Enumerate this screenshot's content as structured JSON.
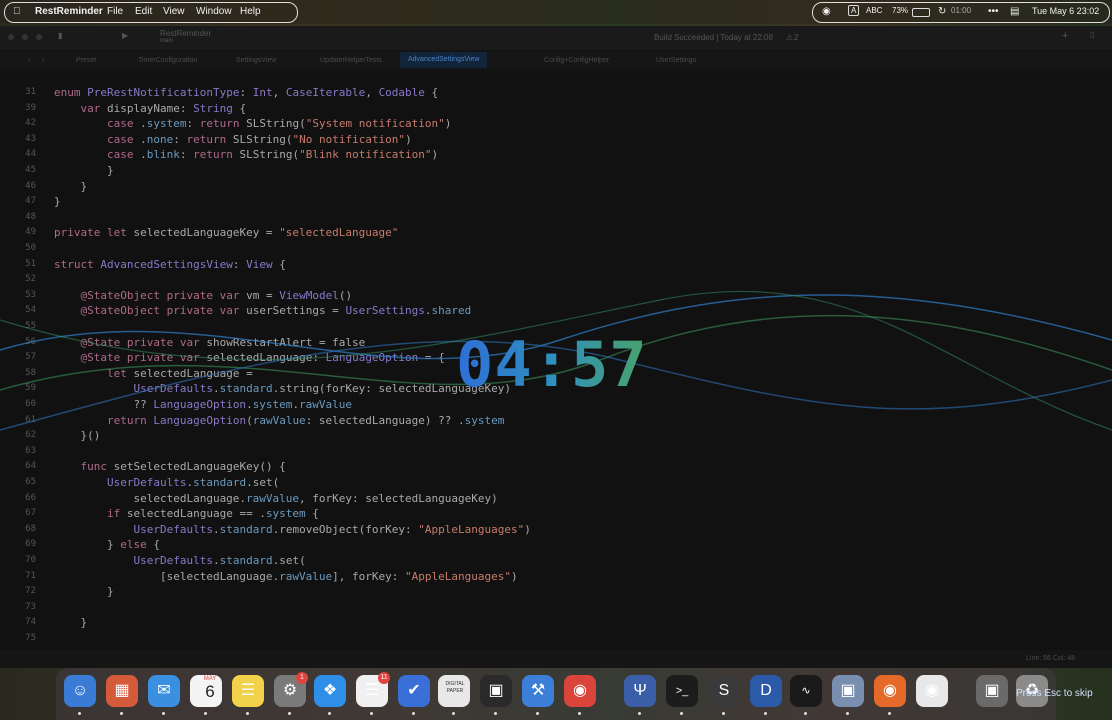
{
  "menubar": {
    "app_name": "RestReminder",
    "menus": [
      "File",
      "Edit",
      "View",
      "Window",
      "Help"
    ],
    "input_source": "ABC",
    "battery": "73%",
    "sync_time": "01:00",
    "datetime": "Tue May 6  23:02"
  },
  "toolbar": {
    "scheme": "RestReminder",
    "branch": "main",
    "build_status": "Build Succeeded | Today at 22:08",
    "warnings": "2"
  },
  "tabs": [
    "Preset",
    "TimerConfiguration",
    "SettingsView",
    "UpdaterHelperTests",
    "AdvancedSettingsView",
    "Config+ConfigHelper",
    "UserSettings"
  ],
  "active_tab": "AdvancedSettingsView",
  "code_lines": [
    {
      "n": "31",
      "t": "enum PreRestNotificationType: Int, CaseIterable, Codable {"
    },
    {
      "n": "39",
      "t": "    var displayName: String {"
    },
    {
      "n": "42",
      "t": "        case .system: return SLString(\"System notification\")"
    },
    {
      "n": "43",
      "t": "        case .none: return SLString(\"No notification\")"
    },
    {
      "n": "44",
      "t": "        case .blink: return SLString(\"Blink notification\")"
    },
    {
      "n": "45",
      "t": "        }"
    },
    {
      "n": "46",
      "t": "    }"
    },
    {
      "n": "47",
      "t": "}"
    },
    {
      "n": "48",
      "t": ""
    },
    {
      "n": "49",
      "t": "private let selectedLanguageKey = \"selectedLanguage\""
    },
    {
      "n": "50",
      "t": ""
    },
    {
      "n": "51",
      "t": "struct AdvancedSettingsView: View {"
    },
    {
      "n": "52",
      "t": ""
    },
    {
      "n": "53",
      "t": "    @StateObject private var vm = ViewModel()"
    },
    {
      "n": "54",
      "t": "    @StateObject private var userSettings = UserSettings.shared"
    },
    {
      "n": "55",
      "t": ""
    },
    {
      "n": "56",
      "t": "    @State private var showRestartAlert = false"
    },
    {
      "n": "57",
      "t": "    @State private var selectedLanguage: LanguageOption = {"
    },
    {
      "n": "58",
      "t": "        let selectedLanguage ="
    },
    {
      "n": "59",
      "t": "            UserDefaults.standard.string(forKey: selectedLanguageKey)"
    },
    {
      "n": "60",
      "t": "            ?? LanguageOption.system.rawValue"
    },
    {
      "n": "61",
      "t": "        return LanguageOption(rawValue: selectedLanguage) ?? .system"
    },
    {
      "n": "62",
      "t": "    }()"
    },
    {
      "n": "63",
      "t": ""
    },
    {
      "n": "64",
      "t": "    func setSelectedLanguageKey() {"
    },
    {
      "n": "65",
      "t": "        UserDefaults.standard.set("
    },
    {
      "n": "66",
      "t": "            selectedLanguage.rawValue, forKey: selectedLanguageKey)"
    },
    {
      "n": "67",
      "t": "        if selectedLanguage == .system {"
    },
    {
      "n": "68",
      "t": "            UserDefaults.standard.removeObject(forKey: \"AppleLanguages\")"
    },
    {
      "n": "69",
      "t": "        } else {"
    },
    {
      "n": "70",
      "t": "            UserDefaults.standard.set("
    },
    {
      "n": "71",
      "t": "                [selectedLanguage.rawValue], forKey: \"AppleLanguages\")"
    },
    {
      "n": "72",
      "t": "        }"
    },
    {
      "n": "73",
      "t": ""
    },
    {
      "n": "74",
      "t": "    }"
    },
    {
      "n": "75",
      "t": ""
    }
  ],
  "status": {
    "cursor": "Line: 56  Col: 48"
  },
  "timer": {
    "value": "04:57"
  },
  "dock": {
    "calendar_month": "MAY",
    "calendar_day": "6",
    "settings_badge": "1",
    "reminders_badge": "11",
    "digital_paper_label": "DIGITAL PAPER",
    "skip_hint": "Press Esc to skip",
    "icons": [
      "finder-icon",
      "launchpad-icon",
      "mail-icon",
      "calendar-icon",
      "notes-icon",
      "system-settings-icon",
      "safari-icon",
      "reminders-icon",
      "things-icon",
      "digital-paper-icon",
      "box-icon",
      "xcode-icon",
      "chrome-icon",
      "fork-icon",
      "terminal-icon",
      "sublime-icon",
      "dash-icon",
      "activity-monitor-icon",
      "preview-icon",
      "firefox-icon",
      "eye-icon",
      "archive-icon",
      "trash-icon"
    ]
  },
  "colors": {
    "timer_start": "#2e6fd6",
    "timer_end": "#4aa26a",
    "active_tab": "#4a84c8"
  }
}
